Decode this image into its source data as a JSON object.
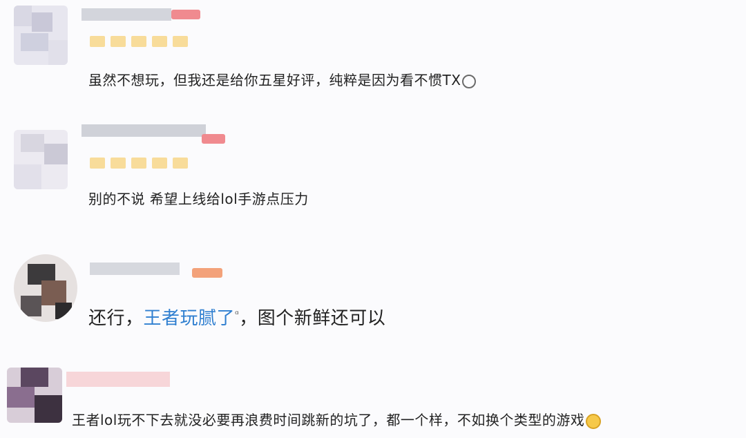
{
  "comments": [
    {
      "text": "虽然不想玩，但我还是给你五星好评，纯粹是因为看不惯TX",
      "emoji": "smiley-wink-icon"
    },
    {
      "text": "别的不说 希望上线给lol手游点压力"
    },
    {
      "text_before": "还行，",
      "text_highlight": "王者玩腻了",
      "text_sup": "ᵅ",
      "text_after": "，图个新鲜还可以"
    },
    {
      "text": "王者lol玩不下去就没必要再浪费时间跳新的坑了，都一个样，不如换个类型的游戏",
      "emoji": "grin-face-icon"
    }
  ],
  "colors": {
    "highlight": "#2f7fd0",
    "badge_red": "#f08a8f",
    "badge_orange": "#f3a27a",
    "stars": "#f8dc9a"
  }
}
